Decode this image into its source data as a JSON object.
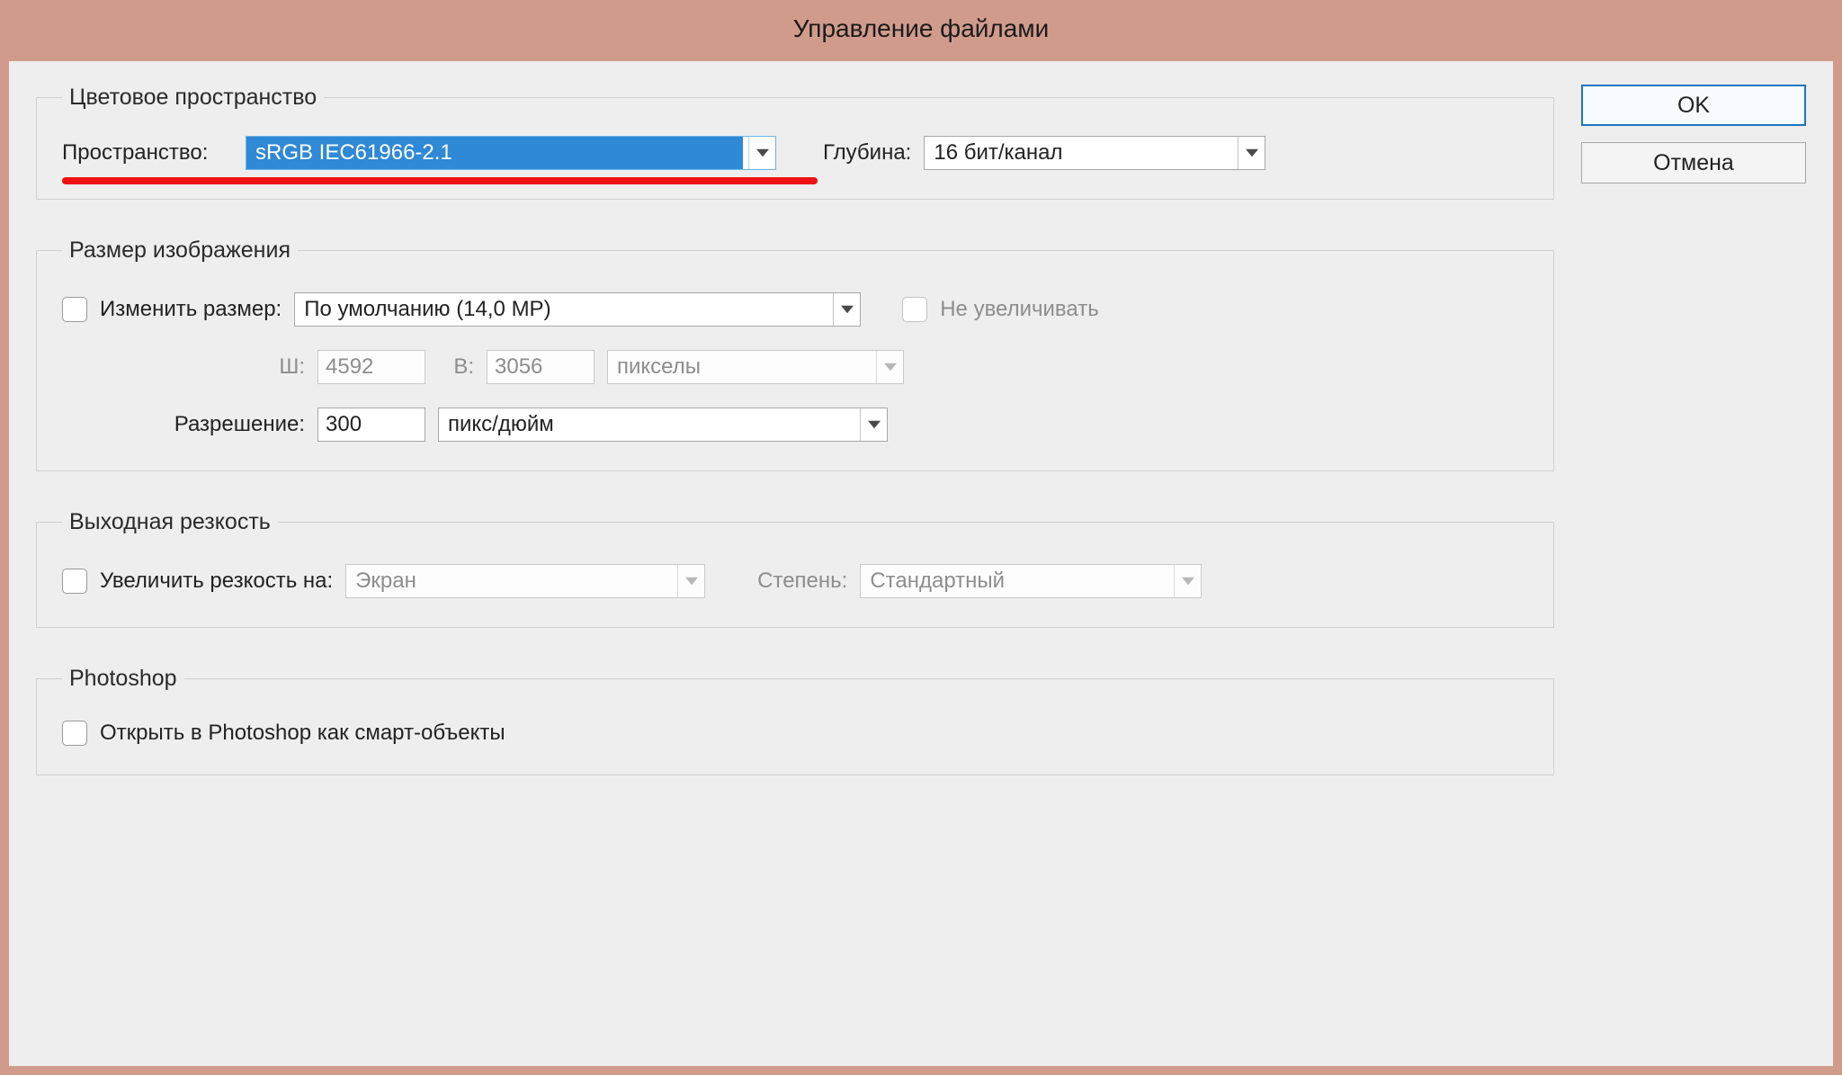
{
  "title": "Управление файлами",
  "buttons": {
    "ok": "OK",
    "cancel": "Отмена"
  },
  "color_space": {
    "legend": "Цветовое пространство",
    "space_label": "Пространство:",
    "space_value": "sRGB IEC61966-2.1",
    "depth_label": "Глубина:",
    "depth_value": "16 бит/канал",
    "underline_highlight": true
  },
  "image_size": {
    "legend": "Размер изображения",
    "resize_label": "Изменить размер:",
    "resize_value": "По умолчанию (14,0 MP)",
    "no_upscale_label": "Не увеличивать",
    "w_label": "Ш:",
    "w_value": "4592",
    "h_label": "В:",
    "h_value": "3056",
    "unit_value": "пикселы",
    "resolution_label": "Разрешение:",
    "resolution_value": "300",
    "resolution_unit_value": "пикс/дюйм"
  },
  "output_sharpen": {
    "legend": "Выходная резкость",
    "enable_label": "Увеличить резкость на:",
    "target_value": "Экран",
    "amount_label": "Степень:",
    "amount_value": "Стандартный"
  },
  "photoshop": {
    "legend": "Photoshop",
    "open_smart_label": "Открыть в Photoshop как смарт-объекты"
  }
}
